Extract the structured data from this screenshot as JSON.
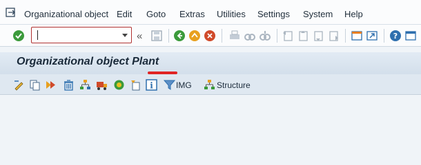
{
  "menubar": {
    "items": [
      {
        "label": "Organizational object",
        "icon": "menu-toggle-icon"
      },
      {
        "label": "Edit"
      },
      {
        "label": "Goto"
      },
      {
        "label": "Extras"
      },
      {
        "label": "Utilities"
      },
      {
        "label": "Settings"
      },
      {
        "label": "System"
      },
      {
        "label": "Help"
      }
    ]
  },
  "toolbar": {
    "command_field_value": "",
    "icons": [
      "enter-icon",
      "save-icon",
      "back-icon",
      "exit-icon",
      "cancel-icon",
      "print-icon",
      "find-icon",
      "find-next-icon",
      "first-page-icon",
      "previous-page-icon",
      "next-page-icon",
      "last-page-icon",
      "create-session-icon",
      "shortcut-icon",
      "help-icon",
      "customize-layout-icon"
    ]
  },
  "title": {
    "text": "Organizational object Plant"
  },
  "app_toolbar": {
    "img_label": "IMG",
    "structure_label": "Structure",
    "icons": [
      "change-icon",
      "copy-icon",
      "copy-to-icon",
      "delete-icon",
      "hierarchy-icon",
      "transport-icon",
      "check-icon",
      "assign-icon",
      "info-icon",
      "filter-icon",
      "structure-icon"
    ]
  },
  "colors": {
    "annotation": "#e02424",
    "command_border": "#b03030",
    "titlebar": "#d9e4ef"
  }
}
